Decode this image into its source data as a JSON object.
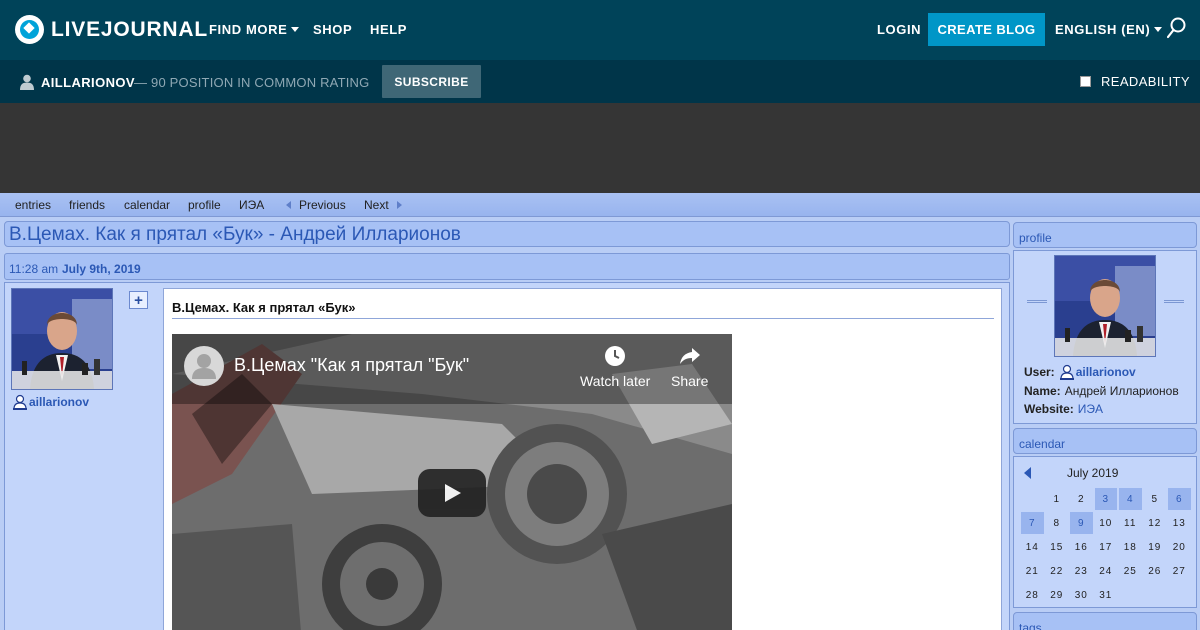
{
  "topbar": {
    "logo_text": "LIVEJOURNAL",
    "nav": [
      {
        "label": "FIND MORE",
        "has_dropdown": true
      },
      {
        "label": "SHOP",
        "has_dropdown": false
      },
      {
        "label": "HELP",
        "has_dropdown": false
      }
    ],
    "login_label": "LOGIN",
    "create_blog_label": "CREATE BLOG",
    "language_label": "ENGLISH (EN)",
    "icons": {
      "logo": "livejournal-logo-icon",
      "search": "search-icon"
    }
  },
  "userbar": {
    "username": "AILLARIONOV",
    "rating": "— 90 POSITION IN COMMON RATING",
    "subscribe_label": "SUBSCRIBE",
    "readability_label": "READABILITY",
    "readability_checked": false
  },
  "journal_nav": {
    "items": [
      "entries",
      "friends",
      "calendar",
      "profile",
      "ИЭА"
    ],
    "previous_label": "Previous",
    "next_label": "Next"
  },
  "entry": {
    "title": "В.Цемах. Как я прятал «Бук» - Андрей Илларионов",
    "time": "11:28 am",
    "date": "July 9th, 2019",
    "username": "aillarionov",
    "plus_label": "+",
    "subject": "В.Цемах. Как я прятал «Бук»",
    "video": {
      "title": "В.Цемах \"Как я прятал \"Бук\"",
      "watch_later_label": "Watch later",
      "share_label": "Share"
    }
  },
  "sidebar": {
    "profile": {
      "heading": "profile",
      "user_label": "User:",
      "user_value": "aillarionov",
      "name_label": "Name:",
      "name_value": "Андрей Илларионов",
      "website_label": "Website:",
      "website_value": "ИЭА"
    },
    "calendar": {
      "heading": "calendar",
      "month": "July 2019",
      "days": [
        "",
        "1",
        "2",
        "3",
        "4",
        "5",
        "6",
        "7",
        "8",
        "9",
        "10",
        "11",
        "12",
        "13",
        "14",
        "15",
        "16",
        "17",
        "18",
        "19",
        "20",
        "21",
        "22",
        "23",
        "24",
        "25",
        "26",
        "27",
        "28",
        "29",
        "30",
        "31"
      ],
      "highlighted": [
        "3",
        "4",
        "6",
        "7",
        "9"
      ]
    },
    "tags": {
      "heading": "tags"
    }
  },
  "colors": {
    "topbar": "#004359",
    "userbar": "#003549",
    "accent": "#0096c7",
    "page_bg": "#b9cdf5",
    "link": "#2b58b5"
  }
}
